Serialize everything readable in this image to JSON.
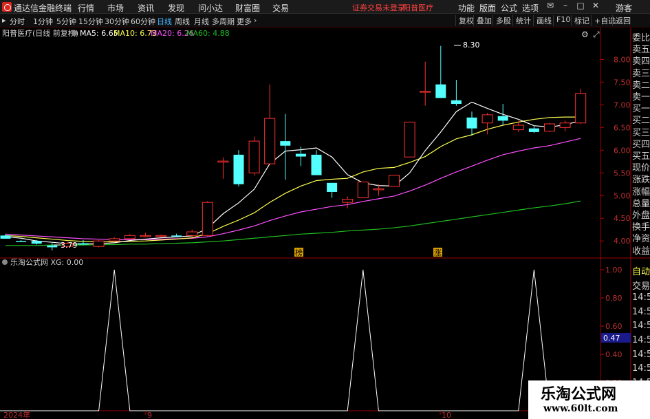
{
  "app": {
    "title": "通达信金融终端",
    "menu": [
      "行情",
      "市场",
      "资讯",
      "发现",
      "问小达",
      "财富圈",
      "交易"
    ],
    "status_login": "证券交易未登录",
    "status_stock": "阳普医疗",
    "right_menu": [
      "功能",
      "版面",
      "公式",
      "选项"
    ],
    "guest": "游客"
  },
  "toolbar": {
    "periods": [
      "分时",
      "1分钟",
      "5分钟",
      "15分钟",
      "30分钟",
      "60分钟",
      "日线",
      "周线",
      "月线",
      "多周期",
      "更多"
    ],
    "active_period": "日线",
    "right_buttons": [
      "复权",
      "叠加",
      "多股",
      "统计",
      "画线",
      "F10",
      "标记",
      "+自选",
      "返回"
    ]
  },
  "main_chart": {
    "header_stock": "阳普医疗(日线 前复权)",
    "ma5": "MA5: 6.65",
    "ma10": "MA10: 6.73",
    "ma20": "MA20: 6.26",
    "ma60": "MA60: 4.88",
    "high_label": "8.30",
    "low_label": "3.79",
    "y_ticks": [
      "8.00",
      "7.50",
      "7.00",
      "6.50",
      "6.00",
      "5.50",
      "5.00",
      "4.50",
      "4.00"
    ],
    "marker_left": "榜",
    "marker_right": "涨",
    "colors": {
      "up": "#ff3232",
      "down": "#54ffff",
      "ma5": "#ffffff",
      "ma10": "#ffff50",
      "ma20": "#ff50ff",
      "ma60": "#20c020",
      "axis": "#c00000"
    }
  },
  "chart_data": {
    "type": "candlestick",
    "ylim": [
      3.7,
      8.4
    ],
    "candles": [
      {
        "o": 4.12,
        "h": 4.15,
        "l": 4.05,
        "c": 4.05
      },
      {
        "o": 4.0,
        "h": 4.02,
        "l": 3.98,
        "c": 3.99
      },
      {
        "o": 4.0,
        "h": 4.02,
        "l": 3.92,
        "c": 3.94
      },
      {
        "o": 3.9,
        "h": 3.95,
        "l": 3.79,
        "c": 3.86
      },
      {
        "o": 3.88,
        "h": 3.98,
        "l": 3.86,
        "c": 3.95
      },
      {
        "o": 3.95,
        "h": 4.02,
        "l": 3.92,
        "c": 3.92
      },
      {
        "o": 3.88,
        "h": 4.02,
        "l": 3.86,
        "c": 4.0
      },
      {
        "o": 4.0,
        "h": 4.08,
        "l": 3.98,
        "c": 4.05
      },
      {
        "o": 4.05,
        "h": 4.15,
        "l": 4.03,
        "c": 4.12
      },
      {
        "o": 4.1,
        "h": 4.18,
        "l": 4.08,
        "c": 4.12
      },
      {
        "o": 4.1,
        "h": 4.14,
        "l": 4.08,
        "c": 4.12
      },
      {
        "o": 4.12,
        "h": 4.16,
        "l": 4.1,
        "c": 4.1
      },
      {
        "o": 4.12,
        "h": 4.25,
        "l": 4.08,
        "c": 4.2
      },
      {
        "o": 4.12,
        "h": 4.88,
        "l": 4.1,
        "c": 4.85
      },
      {
        "o": 5.76,
        "h": 5.84,
        "l": 5.37,
        "c": 5.76
      },
      {
        "o": 5.9,
        "h": 6.0,
        "l": 5.2,
        "c": 5.25
      },
      {
        "o": 5.5,
        "h": 6.3,
        "l": 5.45,
        "c": 6.2
      },
      {
        "o": 5.7,
        "h": 7.45,
        "l": 5.7,
        "c": 6.7
      },
      {
        "o": 6.2,
        "h": 6.8,
        "l": 5.35,
        "c": 6.1
      },
      {
        "o": 5.92,
        "h": 6.08,
        "l": 5.65,
        "c": 5.86
      },
      {
        "o": 5.9,
        "h": 6.0,
        "l": 5.45,
        "c": 5.45
      },
      {
        "o": 5.28,
        "h": 5.28,
        "l": 4.95,
        "c": 5.08
      },
      {
        "o": 4.85,
        "h": 4.98,
        "l": 4.72,
        "c": 4.92
      },
      {
        "o": 4.95,
        "h": 5.3,
        "l": 4.95,
        "c": 5.3
      },
      {
        "o": 5.15,
        "h": 5.25,
        "l": 5.0,
        "c": 5.15
      },
      {
        "o": 5.2,
        "h": 5.45,
        "l": 5.2,
        "c": 5.45
      },
      {
        "o": 5.85,
        "h": 6.62,
        "l": 5.85,
        "c": 6.62
      },
      {
        "o": 7.3,
        "h": 7.95,
        "l": 6.98,
        "c": 7.3
      },
      {
        "o": 7.45,
        "h": 8.3,
        "l": 7.15,
        "c": 7.15
      },
      {
        "o": 7.1,
        "h": 7.55,
        "l": 6.98,
        "c": 7.02
      },
      {
        "o": 6.72,
        "h": 6.85,
        "l": 6.32,
        "c": 6.48
      },
      {
        "o": 6.6,
        "h": 6.82,
        "l": 6.35,
        "c": 6.78
      },
      {
        "o": 6.75,
        "h": 7.02,
        "l": 6.55,
        "c": 6.65
      },
      {
        "o": 6.45,
        "h": 6.65,
        "l": 6.4,
        "c": 6.55
      },
      {
        "o": 6.48,
        "h": 6.55,
        "l": 6.38,
        "c": 6.4
      },
      {
        "o": 6.42,
        "h": 6.6,
        "l": 6.4,
        "c": 6.58
      },
      {
        "o": 6.5,
        "h": 6.65,
        "l": 6.42,
        "c": 6.6
      },
      {
        "o": 6.6,
        "h": 7.35,
        "l": 6.58,
        "c": 7.25
      }
    ],
    "ma5": [
      4.1,
      4.06,
      4.0,
      3.97,
      3.94,
      3.93,
      3.94,
      3.96,
      4.01,
      4.04,
      4.07,
      4.09,
      4.11,
      4.28,
      4.6,
      4.84,
      5.14,
      5.7,
      5.98,
      6.01,
      6.05,
      5.85,
      5.46,
      5.28,
      5.22,
      5.21,
      5.5,
      5.99,
      6.4,
      6.85,
      7.06,
      6.92,
      6.79,
      6.68,
      6.54,
      6.51,
      6.56,
      6.65
    ],
    "ma10": [
      4.12,
      4.1,
      4.07,
      4.04,
      4.01,
      3.99,
      3.98,
      3.98,
      3.99,
      4.0,
      4.02,
      4.04,
      4.07,
      4.16,
      4.32,
      4.46,
      4.62,
      4.85,
      5.05,
      5.21,
      5.33,
      5.36,
      5.38,
      5.52,
      5.6,
      5.62,
      5.73,
      5.86,
      6.08,
      6.25,
      6.34,
      6.46,
      6.55,
      6.62,
      6.68,
      6.72,
      6.73,
      6.73
    ],
    "ma20": [
      4.15,
      4.13,
      4.11,
      4.09,
      4.07,
      4.05,
      4.04,
      4.03,
      4.03,
      4.03,
      4.04,
      4.05,
      4.06,
      4.09,
      4.16,
      4.24,
      4.33,
      4.45,
      4.55,
      4.64,
      4.7,
      4.76,
      4.8,
      4.87,
      4.93,
      4.99,
      5.1,
      5.23,
      5.38,
      5.52,
      5.65,
      5.78,
      5.9,
      5.98,
      6.05,
      6.1,
      6.18,
      6.26
    ],
    "ma60": [
      3.9,
      3.9,
      3.9,
      3.91,
      3.91,
      3.91,
      3.92,
      3.92,
      3.93,
      3.93,
      3.94,
      3.95,
      3.96,
      3.98,
      4.0,
      4.03,
      4.06,
      4.09,
      4.12,
      4.15,
      4.17,
      4.19,
      4.22,
      4.24,
      4.26,
      4.29,
      4.33,
      4.38,
      4.43,
      4.48,
      4.53,
      4.58,
      4.63,
      4.68,
      4.73,
      4.77,
      4.82,
      4.88
    ]
  },
  "sub_chart": {
    "header": "乐淘公式网 XG: 0.00",
    "y_ticks": [
      "1.00",
      "0.80",
      "0.60",
      "0.40",
      "0.20"
    ],
    "crosshair_value": "0.47",
    "xg_signal": [
      0,
      0,
      0,
      0,
      0,
      0,
      0,
      1,
      0,
      0,
      0,
      0,
      0,
      0,
      0,
      0,
      0,
      0,
      0,
      0,
      0,
      0,
      0,
      1,
      0,
      0,
      0,
      0,
      0,
      0,
      0,
      0,
      0,
      0,
      1,
      0,
      0,
      0
    ],
    "x_labels": [
      "2024年",
      "9",
      "10"
    ]
  },
  "side_panel": {
    "main": [
      "委比",
      "卖五",
      "卖四",
      "卖三",
      "卖二",
      "卖一",
      "买一",
      "买二",
      "买三",
      "买四",
      "买五",
      "现价",
      "涨跌",
      "涨幅",
      "总量",
      "外盘",
      "换手",
      "净资",
      "收益"
    ],
    "sub": [
      "自动",
      "交易",
      "14:56",
      "14:56",
      "14:56",
      "14:56",
      "14:56",
      "14:56",
      "14:56"
    ]
  },
  "watermark": {
    "name": "乐淘公式网",
    "url": "www.60lt.com"
  }
}
